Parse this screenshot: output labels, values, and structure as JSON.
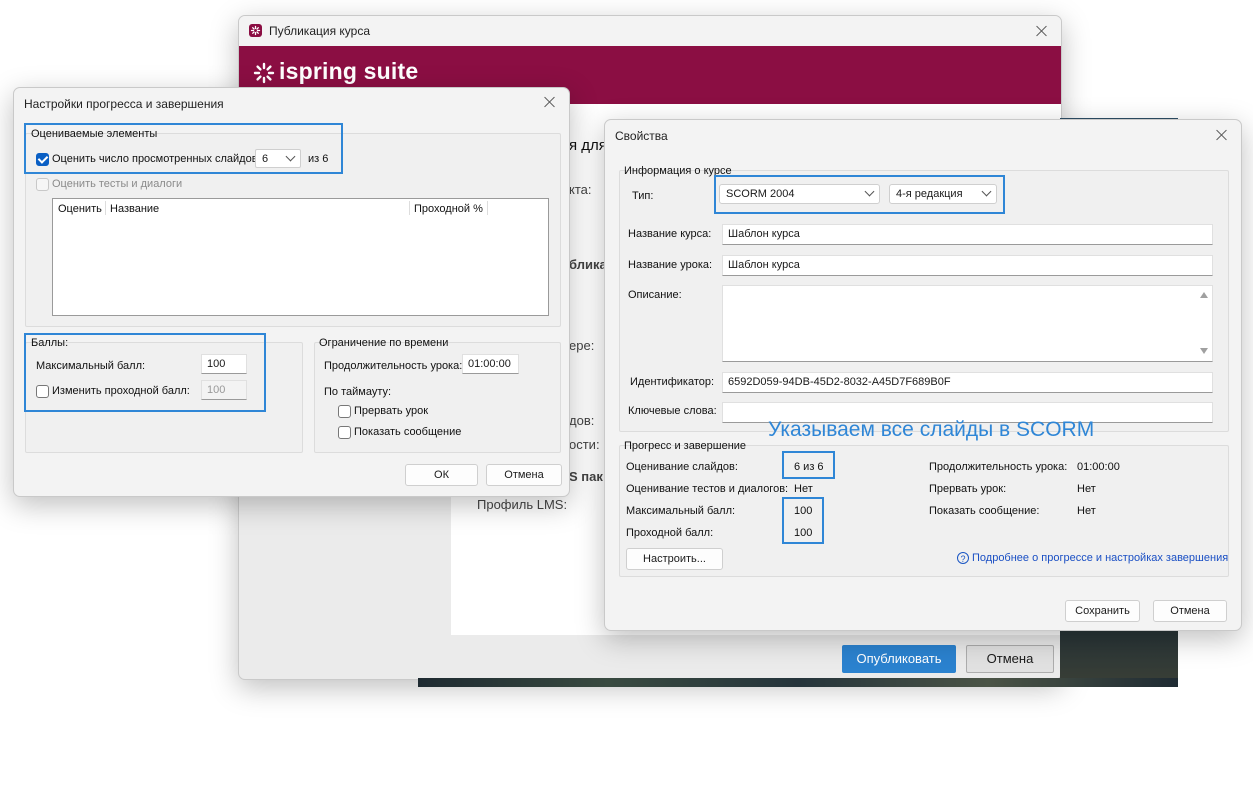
{
  "colors": {
    "brand": "#8b0e43",
    "accent": "#2f86d6",
    "primary_button": "#2b82cf"
  },
  "publish_window": {
    "title": "Публикация курса",
    "brand_name": "ispring suite",
    "partial_labels": {
      "heading": "я для",
      "l1": "кта:",
      "l2": "блика",
      "l3": "ере:",
      "l4": "дов:",
      "l5": "ости:",
      "l6": "S пак",
      "lms_profile": "Профиль LMS:"
    },
    "publish_button": "Опубликовать",
    "cancel_button": "Отмена"
  },
  "progress_dialog": {
    "title": "Настройки прогресса и завершения",
    "evaluated": {
      "legend": "Оцениваемые элементы",
      "count_slides_label": "Оценить число просмотренных слайдов:",
      "slides_value": "6",
      "of_total": "из 6",
      "count_tests_label": "Оценить тесты и диалоги",
      "columns": [
        "Оценить",
        "Название",
        "Проходной %"
      ]
    },
    "score": {
      "legend": "Баллы:",
      "max_label": "Максимальный балл:",
      "max_value": "100",
      "change_pass_label": "Изменить проходной балл:",
      "pass_value": "100"
    },
    "time": {
      "legend": "Ограничение по времени",
      "duration_label": "Продолжительность урока:",
      "duration_value": "01:00:00",
      "timeout_label": "По таймауту:",
      "interrupt_label": "Прервать урок",
      "show_message_label": "Показать сообщение"
    },
    "ok_button": "ОК",
    "cancel_button": "Отмена"
  },
  "properties_dialog": {
    "title": "Свойства",
    "course_info": {
      "legend": "Информация о курсе",
      "type_label": "Тип:",
      "type_value": "SCORM 2004",
      "edition_value": "4-я редакция",
      "course_name_label": "Название курса:",
      "course_name_value": "Шаблон курса",
      "lesson_name_label": "Название урока:",
      "lesson_name_value": "Шаблон курса",
      "description_label": "Описание:",
      "description_value": "",
      "identifier_label": "Идентификатор:",
      "identifier_value": "6592D059-94DB-45D2-8032-A45D7F689B0F",
      "keywords_label": "Ключевые слова:",
      "keywords_value": ""
    },
    "annotation": "Указываем все слайды в SCORM",
    "progress": {
      "legend": "Прогресс и завершение",
      "slides_eval_label": "Оценивание слайдов:",
      "slides_eval_value": "6 из 6",
      "tests_eval_label": "Оценивание тестов и диалогов:",
      "tests_eval_value": "Нет",
      "max_score_label": "Максимальный балл:",
      "max_score_value": "100",
      "pass_score_label": "Проходной балл:",
      "pass_score_value": "100",
      "duration_label": "Продолжительность урока:",
      "duration_value": "01:00:00",
      "interrupt_label": "Прервать урок:",
      "interrupt_value": "Нет",
      "show_message_label": "Показать сообщение:",
      "show_message_value": "Нет",
      "configure_button": "Настроить...",
      "help_link": "Подробнее о прогрессе и настройках завершения"
    },
    "save_button": "Сохранить",
    "cancel_button": "Отмена"
  }
}
